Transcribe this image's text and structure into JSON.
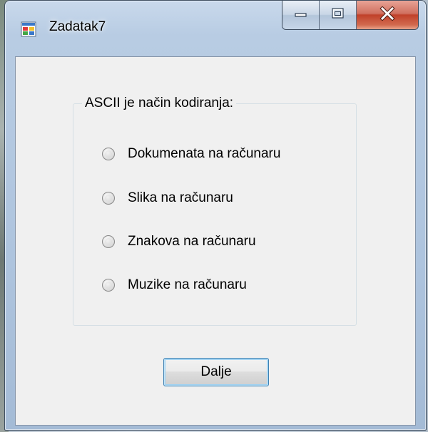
{
  "window": {
    "title": "Zadatak7",
    "icon": "windows-form-app-icon",
    "caption_buttons": [
      {
        "name": "minimize",
        "icon": "minimize-icon"
      },
      {
        "name": "maximize",
        "icon": "maximize-icon"
      },
      {
        "name": "close",
        "icon": "close-icon"
      }
    ]
  },
  "question_group": {
    "legend": "ASCII je način kodiranja:",
    "options": [
      {
        "label": "Dokumenata na računaru",
        "selected": false
      },
      {
        "label": "Slika na računaru",
        "selected": false
      },
      {
        "label": "Znakova na računaru",
        "selected": false
      },
      {
        "label": "Muzike na računaru",
        "selected": false
      }
    ]
  },
  "next_button": {
    "label": "Dalje"
  },
  "colors": {
    "close_button": "#c0412a",
    "client_background": "#f0f0f0",
    "focused_button_border": "#3c7fb1"
  }
}
